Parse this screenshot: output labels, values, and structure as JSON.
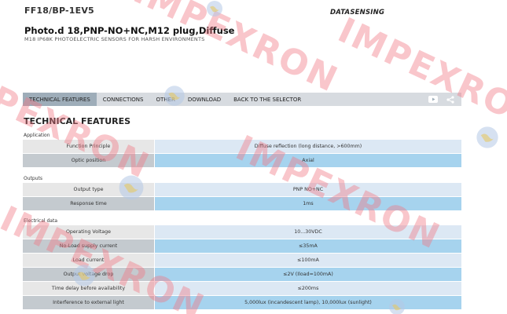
{
  "header": {
    "model": "FF18/BP-1EV5",
    "brand": "DATASENSING",
    "title": "Photo.d 18,PNP-NO+NC,M12 plug,Diffuse",
    "subtitle": "M18 IP68K PHOTOELECTRIC SENSORS FOR HARSH ENVIRONMENTS"
  },
  "nav": {
    "tabs": [
      {
        "label": "TECHNICAL FEATURES",
        "active": true
      },
      {
        "label": "CONNECTIONS",
        "active": false
      },
      {
        "label": "OTHER",
        "active": false
      },
      {
        "label": "DOWNLOAD",
        "active": false
      },
      {
        "label": "BACK TO THE SELECTOR",
        "active": false
      }
    ],
    "icons": [
      "youtube-icon",
      "share-icon"
    ]
  },
  "section_title": "TECHNICAL FEATURES",
  "groups": [
    {
      "label": "Application",
      "rows": [
        {
          "label": "Function Principle",
          "value": "Diffuse reflection (long distance, >600mm)"
        },
        {
          "label": "Optic position",
          "value": "Axial"
        }
      ]
    },
    {
      "label": "Outputs",
      "rows": [
        {
          "label": "Output type",
          "value": "PNP NO+NC"
        },
        {
          "label": "Response time",
          "value": "1ms"
        }
      ]
    },
    {
      "label": "Electrical data",
      "rows": [
        {
          "label": "Operating Voltage",
          "value": "10...30VDC"
        },
        {
          "label": "No-Load supply current",
          "value": "≤35mA"
        },
        {
          "label": "Load current",
          "value": "≤100mA"
        },
        {
          "label": "Output voltage drop",
          "value": "≤2V (Iload=100mA)"
        },
        {
          "label": "Time delay before availability",
          "value": "≤200ms"
        },
        {
          "label": "Interference to external light",
          "value": "5,000lux (incandescent lamp), 10,000lux (sunlight)"
        }
      ]
    }
  ],
  "watermark": "IMPEXRON",
  "colors": {
    "nav_bg": "#d7dbe0",
    "nav_active": "#9eadb9",
    "label_odd": "#e7e7e7",
    "label_even": "#c4cacf",
    "value_odd": "#dce8f4",
    "value_even": "#a6d3ee",
    "watermark": "#f07882"
  }
}
